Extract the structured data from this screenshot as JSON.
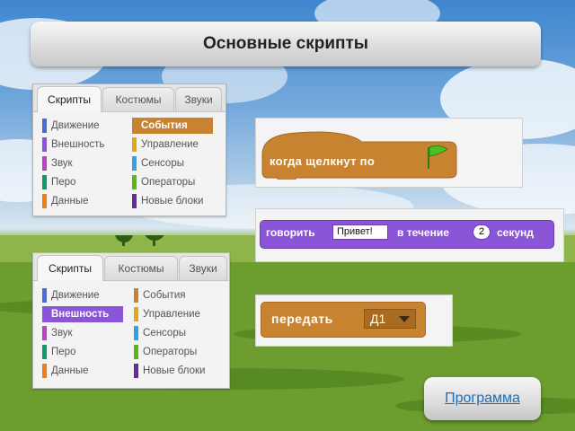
{
  "title": "Основные скрипты",
  "palette1": {
    "tabs": [
      {
        "label": "Скрипты",
        "active": true
      },
      {
        "label": "Костюмы",
        "active": false
      },
      {
        "label": "Звуки",
        "active": false
      }
    ],
    "categories": [
      {
        "label": "Движение",
        "color": "#4a6cd4",
        "selected": false
      },
      {
        "label": "Внешность",
        "color": "#8a55d7",
        "selected": false
      },
      {
        "label": "Звук",
        "color": "#bb42c3",
        "selected": false
      },
      {
        "label": "Перо",
        "color": "#0e9a6c",
        "selected": false
      },
      {
        "label": "Данные",
        "color": "#ee7d16",
        "selected": false
      },
      {
        "label": "События",
        "color": "#c88330",
        "selected": true
      },
      {
        "label": "Управление",
        "color": "#e1a91a",
        "selected": false
      },
      {
        "label": "Сенсоры",
        "color": "#2ca5e2",
        "selected": false
      },
      {
        "label": "Операторы",
        "color": "#5cb712",
        "selected": false
      },
      {
        "label": "Новые блоки",
        "color": "#632d99",
        "selected": false
      }
    ]
  },
  "palette2": {
    "tabs": [
      {
        "label": "Скрипты",
        "active": true
      },
      {
        "label": "Костюмы",
        "active": false
      },
      {
        "label": "Звуки",
        "active": false
      }
    ],
    "categories": [
      {
        "label": "Движение",
        "color": "#4a6cd4",
        "selected": false
      },
      {
        "label": "Внешность",
        "color": "#8a55d7",
        "selected": true
      },
      {
        "label": "Звук",
        "color": "#bb42c3",
        "selected": false
      },
      {
        "label": "Перо",
        "color": "#0e9a6c",
        "selected": false
      },
      {
        "label": "Данные",
        "color": "#ee7d16",
        "selected": false
      },
      {
        "label": "События",
        "color": "#c88330",
        "selected": false
      },
      {
        "label": "Управление",
        "color": "#e1a91a",
        "selected": false
      },
      {
        "label": "Сенсоры",
        "color": "#2ca5e2",
        "selected": false
      },
      {
        "label": "Операторы",
        "color": "#5cb712",
        "selected": false
      },
      {
        "label": "Новые блоки",
        "color": "#632d99",
        "selected": false
      }
    ]
  },
  "blocks": {
    "event_label": "когда щелкнут по",
    "event_icon": "green-flag-icon",
    "say_word1": "говорить",
    "say_text": "Привет!",
    "say_word2": "в течение",
    "say_seconds": "2",
    "say_word3": "секунд",
    "broadcast_label": "передать",
    "broadcast_value": "Д1"
  },
  "program_button": "Программа",
  "colors": {
    "events": "#c88330",
    "looks": "#8a55d7"
  }
}
